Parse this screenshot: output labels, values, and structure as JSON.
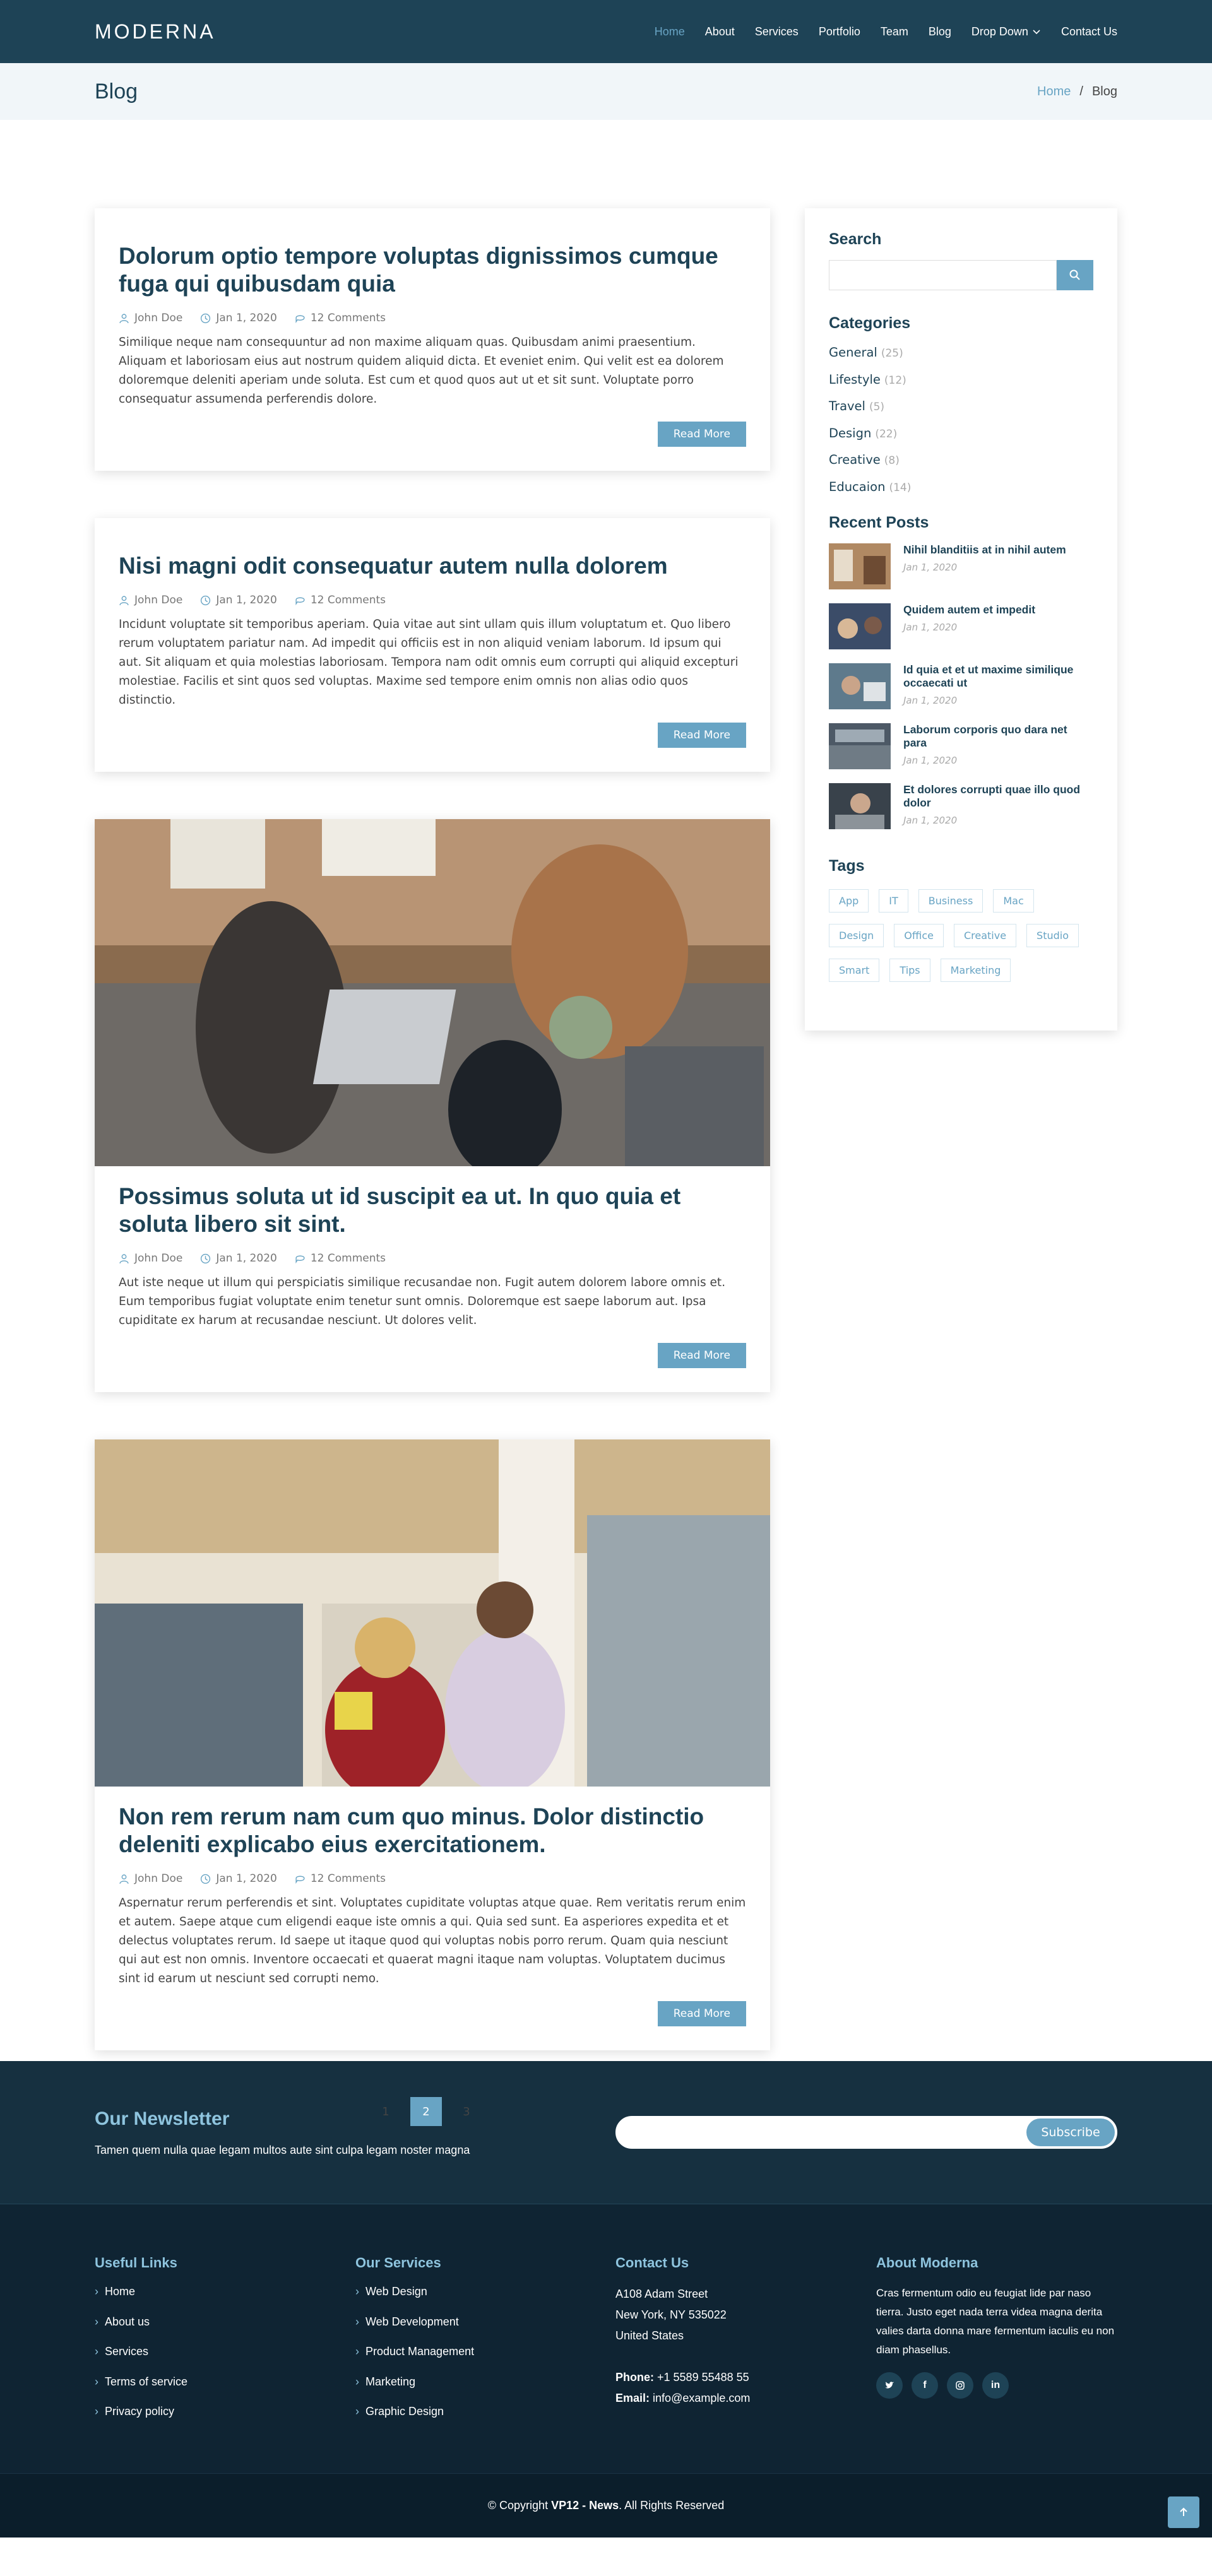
{
  "header": {
    "logo": "MODERNA",
    "nav": [
      "Home",
      "About",
      "Services",
      "Portfolio",
      "Team",
      "Blog",
      "Drop Down",
      "Contact Us"
    ]
  },
  "breadcrumb": {
    "title": "Blog",
    "home": "Home",
    "separator": "/",
    "current": "Blog"
  },
  "entries": [
    {
      "title": "Dolorum optio tempore voluptas dignissimos cumque fuga qui quibusdam quia",
      "author": "John Doe",
      "date": "Jan 1, 2020",
      "comments": "12 Comments",
      "text": "Similique neque nam consequuntur ad non maxime aliquam quas. Quibusdam animi praesentium. Aliquam et laboriosam eius aut nostrum quidem aliquid dicta. Et eveniet enim. Qui velit est ea dolorem doloremque deleniti aperiam unde soluta. Est cum et quod quos aut ut et sit sunt. Voluptate porro consequatur assumenda perferendis dolore.",
      "button": "Read More"
    },
    {
      "title": "Nisi magni odit consequatur autem nulla dolorem",
      "author": "John Doe",
      "date": "Jan 1, 2020",
      "comments": "12 Comments",
      "text": "Incidunt voluptate sit temporibus aperiam. Quia vitae aut sint ullam quis illum voluptatum et. Quo libero rerum voluptatem pariatur nam. Ad impedit qui officiis est in non aliquid veniam laborum. Id ipsum qui aut. Sit aliquam et quia molestias laboriosam. Tempora nam odit omnis eum corrupti qui aliquid excepturi molestiae. Facilis et sint quos sed voluptas. Maxime sed tempore enim omnis non alias odio quos distinctio.",
      "button": "Read More"
    },
    {
      "title": "Possimus soluta ut id suscipit ea ut. In quo quia et soluta libero sit sint.",
      "author": "John Doe",
      "date": "Jan 1, 2020",
      "comments": "12 Comments",
      "text": "Aut iste neque ut illum qui perspiciatis similique recusandae non. Fugit autem dolorem labore omnis et. Eum temporibus fugiat voluptate enim tenetur sunt omnis. Doloremque est saepe laborum aut. Ipsa cupiditate ex harum at recusandae nesciunt. Ut dolores velit.",
      "button": "Read More"
    },
    {
      "title": "Non rem rerum nam cum quo minus. Dolor distinctio deleniti explicabo eius exercitationem.",
      "author": "John Doe",
      "date": "Jan 1, 2020",
      "comments": "12 Comments",
      "text": "Aspernatur rerum perferendis et sint. Voluptates cupiditate voluptas atque quae. Rem veritatis rerum enim et autem. Saepe atque cum eligendi eaque iste omnis a qui. Quia sed sunt. Ea asperiores expedita et et delectus voluptates rerum. Id saepe ut itaque quod qui voluptas nobis porro rerum. Quam quia nesciunt qui aut est non omnis. Inventore occaecati et quaerat magni itaque nam voluptas. Voluptatem ducimus sint id earum ut nesciunt sed corrupti nemo.",
      "button": "Read More"
    }
  ],
  "pagination": [
    "1",
    "2",
    "3"
  ],
  "sidebar": {
    "search_title": "Search",
    "categories_title": "Categories",
    "categories": [
      {
        "name": "General",
        "count": "(25)"
      },
      {
        "name": "Lifestyle",
        "count": "(12)"
      },
      {
        "name": "Travel",
        "count": "(5)"
      },
      {
        "name": "Design",
        "count": "(22)"
      },
      {
        "name": "Creative",
        "count": "(8)"
      },
      {
        "name": "Educaion",
        "count": "(14)"
      }
    ],
    "recent_title": "Recent Posts",
    "recent": [
      {
        "title": "Nihil blanditiis at in nihil autem",
        "date": "Jan 1, 2020"
      },
      {
        "title": "Quidem autem et impedit",
        "date": "Jan 1, 2020"
      },
      {
        "title": "Id quia et et ut maxime similique occaecati ut",
        "date": "Jan 1, 2020"
      },
      {
        "title": "Laborum corporis quo dara net para",
        "date": "Jan 1, 2020"
      },
      {
        "title": "Et dolores corrupti quae illo quod dolor",
        "date": "Jan 1, 2020"
      }
    ],
    "tags_title": "Tags",
    "tags": [
      "App",
      "IT",
      "Business",
      "Mac",
      "Design",
      "Office",
      "Creative",
      "Studio",
      "Smart",
      "Tips",
      "Marketing"
    ]
  },
  "newsletter": {
    "title": "Our Newsletter",
    "text": "Tamen quem nulla quae legam multos aute sint culpa legam noster magna",
    "button": "Subscribe"
  },
  "footer": {
    "useful_title": "Useful Links",
    "useful": [
      "Home",
      "About us",
      "Services",
      "Terms of service",
      "Privacy policy"
    ],
    "services_title": "Our Services",
    "services": [
      "Web Design",
      "Web Development",
      "Product Management",
      "Marketing",
      "Graphic Design"
    ],
    "contact_title": "Contact Us",
    "address1": "A108 Adam Street",
    "address2": "New York, NY 535022",
    "address3": "United States",
    "phone_label": "Phone:",
    "phone": "+1 5589 55488 55",
    "email_label": "Email:",
    "email": "info@example.com",
    "about_title": "About Moderna",
    "about_text": "Cras fermentum odio eu feugiat lide par naso tierra. Justo eget nada terra videa magna derita valies darta donna mare fermentum iaculis eu non diam phasellus.",
    "socials": [
      "twitter-icon",
      "facebook-icon",
      "instagram-icon",
      "linkedin-icon"
    ]
  },
  "copyright": {
    "prefix": "© Copyright ",
    "brand": "VP12 - News",
    "suffix": ". All Rights Reserved"
  },
  "colors": {
    "header": "#1e4356",
    "accent": "#68a4c4",
    "newsletter_bg": "#163040",
    "footer_bg": "#0f2433"
  }
}
